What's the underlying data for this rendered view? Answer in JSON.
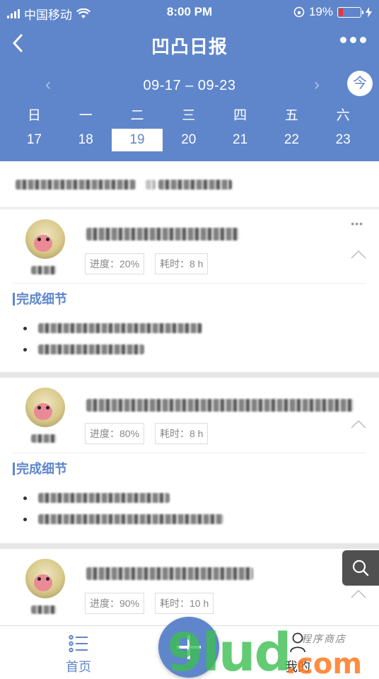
{
  "status_bar": {
    "carrier": "中国移动",
    "time": "8:00 PM",
    "battery": "19%",
    "battery_level": 0.19
  },
  "header": {
    "title": "凹凸日报",
    "range": "09-17 – 09-23",
    "today_label": "今"
  },
  "week": {
    "days": [
      "日",
      "一",
      "二",
      "三",
      "四",
      "五",
      "六"
    ],
    "dates": [
      "17",
      "18",
      "19",
      "20",
      "21",
      "22",
      "23"
    ],
    "selected": "19"
  },
  "cards": [
    {
      "progress": "进度：20%",
      "time": "耗时：8 h",
      "section": "完成细节"
    },
    {
      "progress": "进度：80%",
      "time": "耗时：8 h",
      "section": "完成细节"
    },
    {
      "progress": "进度：90%",
      "time": "耗时：10 h"
    }
  ],
  "tabbar": {
    "home": "首页",
    "me": "我的"
  },
  "watermark": {
    "main": "9lud",
    "suffix": ".com",
    "note": "程序商店"
  },
  "icons": [
    "back-icon",
    "more-icon",
    "wifi-icon",
    "signal-icon",
    "battery-icon",
    "search-icon",
    "list-icon",
    "user-icon",
    "plus-icon",
    "chevron-up-icon"
  ]
}
